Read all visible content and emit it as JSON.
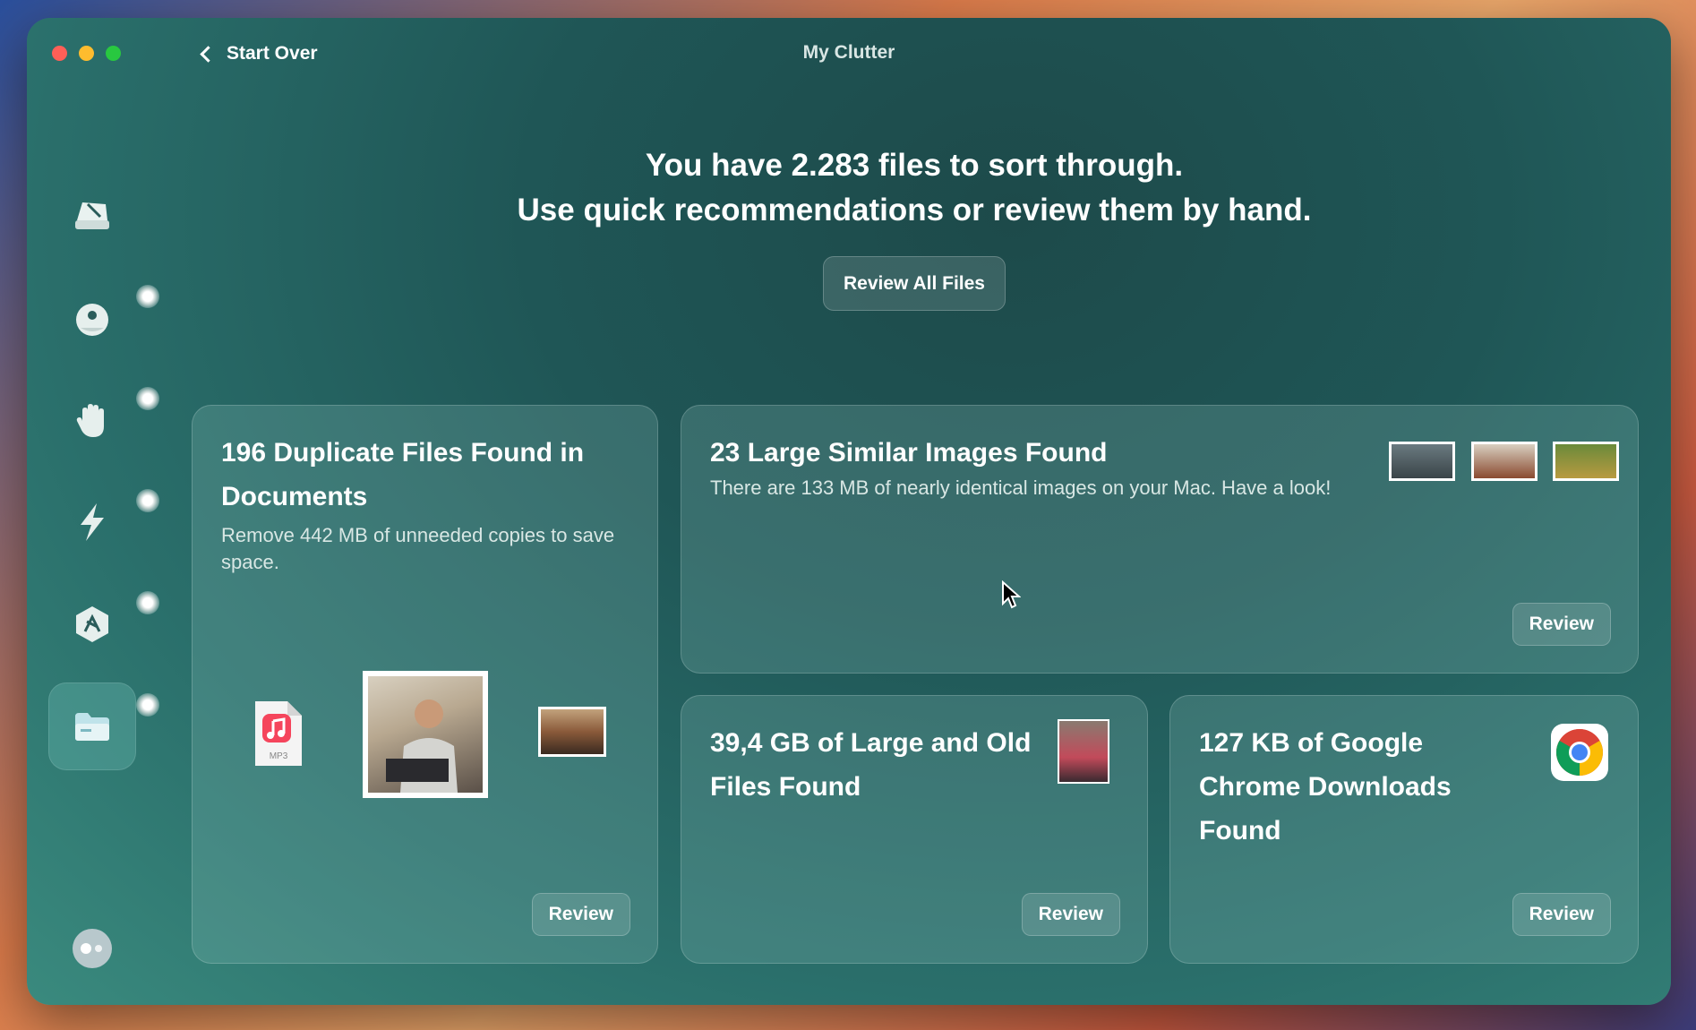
{
  "window": {
    "title": "My Clutter",
    "back_label": "Start Over"
  },
  "sidebar": {
    "items": [
      {
        "icon": "disk-icon"
      },
      {
        "icon": "protection-icon"
      },
      {
        "icon": "hand-icon"
      },
      {
        "icon": "speed-icon"
      },
      {
        "icon": "applications-icon"
      },
      {
        "icon": "folder-icon",
        "active": true
      }
    ],
    "bottom_icon": "assistant-icon"
  },
  "headline": {
    "line1": "You have 2.283 files to sort through.",
    "line2": "Use quick recommendations or review them by hand."
  },
  "review_all_label": "Review All Files",
  "cards": {
    "duplicates": {
      "title": "196 Duplicate Files Found in Documents",
      "description": "Remove 442 MB of unneeded copies to save space.",
      "file_badge": "MP3",
      "review_label": "Review"
    },
    "similar_images": {
      "title": "23 Large Similar Images Found",
      "description": "There are 133 MB of nearly identical images on your Mac. Have a look!",
      "review_label": "Review"
    },
    "large_old": {
      "title": "39,4 GB of Large and Old Files Found",
      "review_label": "Review"
    },
    "chrome_downloads": {
      "title": "127 KB of Google Chrome Downloads Found",
      "review_label": "Review"
    }
  }
}
